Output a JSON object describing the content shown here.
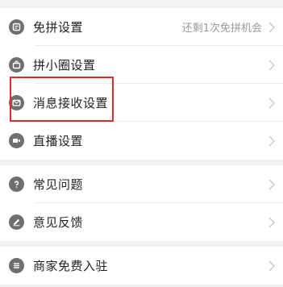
{
  "colors": {
    "background": "#f2f2f2",
    "row_background": "#ffffff",
    "icon_gray": "#6f6f6f",
    "label_text": "#222222",
    "value_text": "#9b9b9b",
    "highlight_border": "#e02b2b"
  },
  "settings_group_1": {
    "items": [
      {
        "label": "免拼设置",
        "value": "还剩1次免拼机会",
        "icon": "clipboard-icon"
      },
      {
        "label": "拼小圈设置",
        "value": "",
        "icon": "bag-icon"
      },
      {
        "label": "消息接收设置",
        "value": "",
        "icon": "mail-icon"
      },
      {
        "label": "直播设置",
        "value": "",
        "icon": "video-icon"
      }
    ]
  },
  "settings_group_2": {
    "items": [
      {
        "label": "常见问题",
        "icon": "question-icon"
      },
      {
        "label": "意见反馈",
        "icon": "pencil-icon"
      }
    ]
  },
  "settings_group_3": {
    "items": [
      {
        "label": "商家免费入驻",
        "icon": "store-icon"
      }
    ]
  }
}
